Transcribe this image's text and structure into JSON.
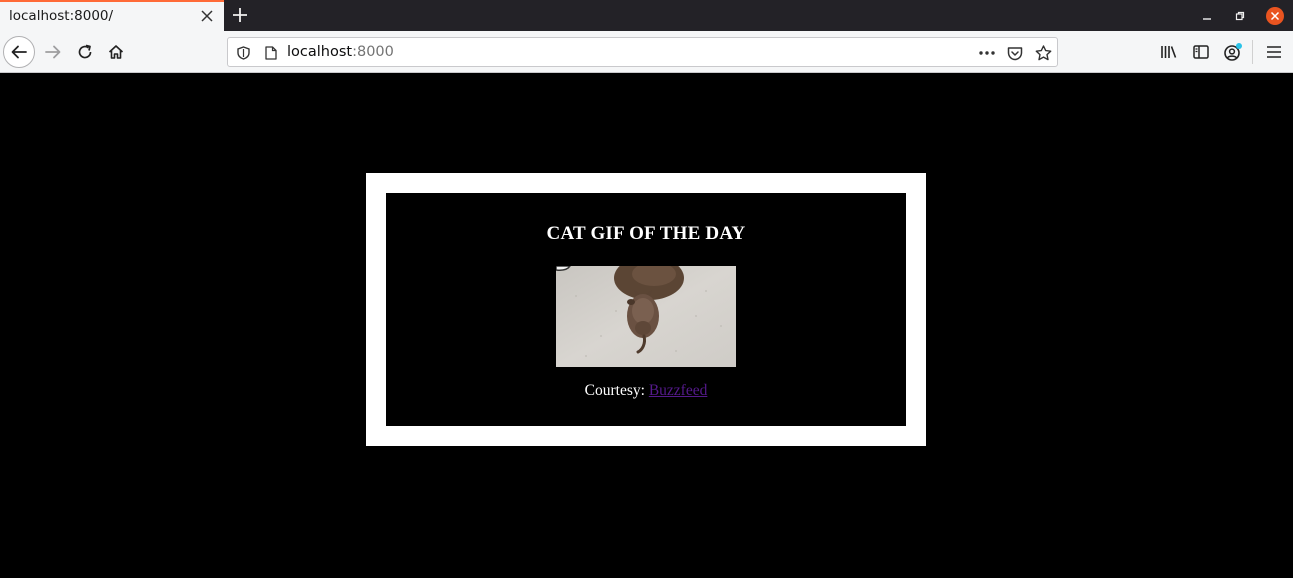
{
  "browser": {
    "tab": {
      "title": "localhost:8000/"
    },
    "url": {
      "host": "localhost",
      "port": ":8000"
    }
  },
  "page": {
    "heading": "CAT GIF OF THE DAY",
    "credit_prefix": "Courtesy: ",
    "credit_link": "Buzzfeed"
  },
  "colors": {
    "page_background": "#000000",
    "frame": "#ffffff",
    "link": "#551a8b",
    "tab_accent": "#ff6a37",
    "close_button": "#e95420"
  },
  "icons": [
    "close-icon",
    "plus-icon",
    "minimize-icon",
    "restore-icon",
    "back-arrow-icon",
    "forward-arrow-icon",
    "reload-icon",
    "home-icon",
    "shield-icon",
    "page-icon",
    "more-icon",
    "pocket-icon",
    "star-icon",
    "library-icon",
    "sidebar-icon",
    "account-icon",
    "menu-icon"
  ]
}
